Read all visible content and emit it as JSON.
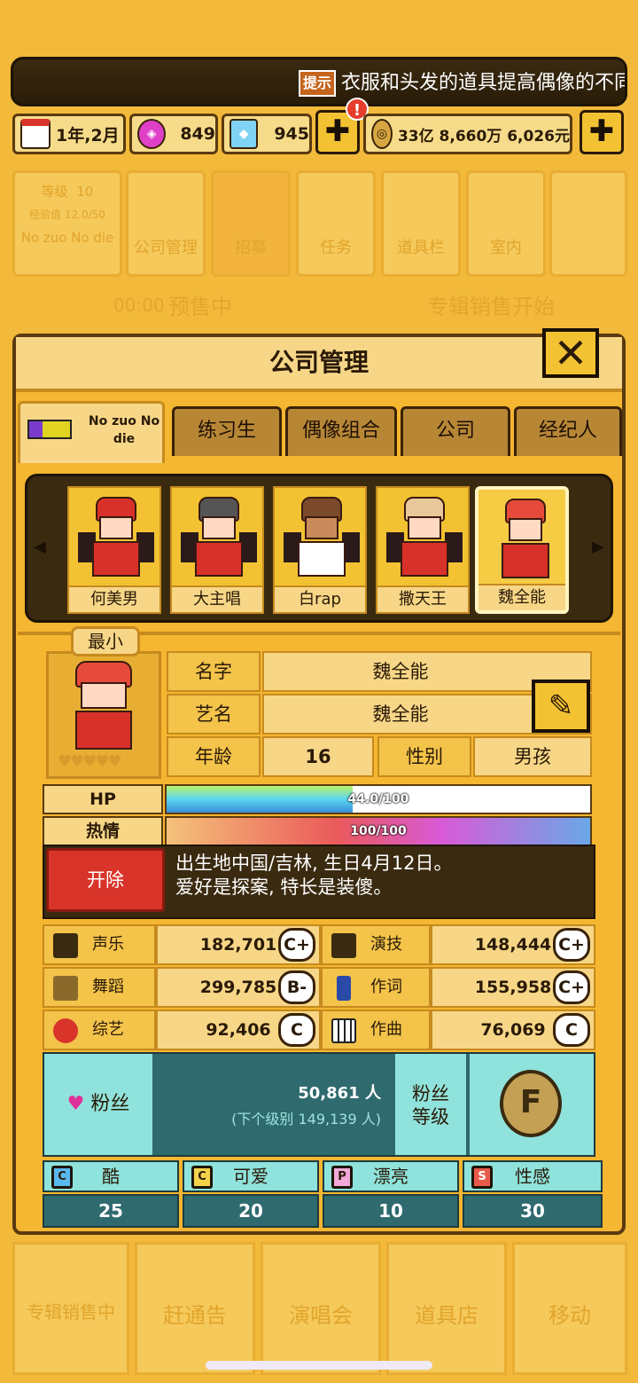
{
  "notice": {
    "tag": "提示",
    "text": "衣服和头发的道具提高偶像的不同"
  },
  "resources": {
    "date": "1年,2月",
    "gem_pink": "849",
    "gem_blue": "945",
    "alert": "!",
    "money": "33亿 8,660万 6,026元",
    "plus": "✚"
  },
  "bg_menu": {
    "level_label": "等级",
    "level_value": "10",
    "exp": "经验值 12.0/50",
    "group": "No zuo No die",
    "items": [
      "公司管理",
      "招募",
      "任务",
      "道具栏",
      "室内"
    ],
    "timer": "00:00",
    "presale": "预售中",
    "album_start": "专辑销售开始"
  },
  "modal": {
    "title": "公司管理",
    "close": "✕",
    "tabs": {
      "active": "No zuo No die",
      "t1": "练习生",
      "t2": "偶像组合",
      "t3": "公司",
      "t4": "经纪人"
    },
    "members": [
      "何美男",
      "大主唱",
      "白rap",
      "撒天王",
      "魏全能"
    ]
  },
  "detail": {
    "badge": "最小",
    "hearts": "♥♥♥♥♥",
    "name_label": "名字",
    "name": "魏全能",
    "stage_label": "艺名",
    "stage_name": "魏全能",
    "age_label": "年龄",
    "age": "16",
    "gender_label": "性别",
    "gender": "男孩",
    "hp_label": "HP",
    "hp": "44.0/100",
    "hp_fraction": 0.44,
    "passion_label": "热情",
    "passion": "100/100",
    "passion_fraction": 1.0,
    "fire": "开除",
    "bio1": "出生地中国/吉林, 生日4月12日。",
    "bio2": "爱好是探案, 特长是装傻。"
  },
  "stats": [
    {
      "l": "声乐",
      "v": "182,701",
      "g": "C+",
      "l2": "演技",
      "v2": "148,444",
      "g2": "C+"
    },
    {
      "l": "舞蹈",
      "v": "299,785",
      "g": "B-",
      "l2": "作词",
      "v2": "155,958",
      "g2": "C+"
    },
    {
      "l": "综艺",
      "v": "92,406",
      "g": "C",
      "l2": "作曲",
      "v2": "76,069",
      "g2": "C"
    }
  ],
  "fans": {
    "label": "粉丝",
    "count": "50,861 人",
    "next": "(下个级别 149,139 人)",
    "lv1": "粉丝",
    "lv2": "等级",
    "grade": "F"
  },
  "attrs": [
    {
      "icon": "C",
      "name": "酷",
      "value": "25"
    },
    {
      "icon": "C",
      "name": "可爱",
      "value": "20"
    },
    {
      "icon": "P",
      "name": "漂亮",
      "value": "10"
    },
    {
      "icon": "S",
      "name": "性感",
      "value": "30"
    }
  ],
  "bottom_nav": [
    "专辑销售中",
    "赶通告",
    "演唱会",
    "道具店",
    "移动"
  ]
}
